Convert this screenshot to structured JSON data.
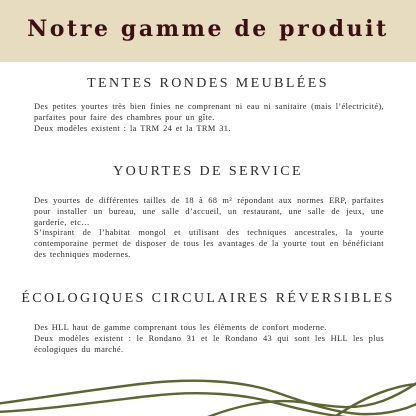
{
  "header": {
    "title": "Notre gamme de produit"
  },
  "sections": [
    {
      "title": "TENTES RONDES MEUBLÉES",
      "paragraphs": [
        "Des petites yourtes très bien finies ne comprenant ni eau ni sanitaire (mais l’électricité), parfaites pour faire des chambres pour un gîte.",
        "Deux modèles existent : la TRM 24 et la TRM 31."
      ]
    },
    {
      "title": "YOURTES DE SERVICE",
      "paragraphs": [
        "Des yourtes de différentes tailles de 18 à 68 m² répondant aux normes ERP, parfaites pour installer un bureau, une salle d’accueil, un restaurant, une salle de jeux, une garderie, etc…",
        "S’inspirant de l’habitat mongol et utilisant des techniques ancestrales, la yourte contemporaine permet de disposer de tous les avantages de la yourte tout en bénéficiant des techniques modernes."
      ]
    },
    {
      "title": "ÉCOLOGIQUES CIRCULAIRES RÉVERSIBLES",
      "paragraphs": [
        "Des HLL haut de gamme comprenant tous les éléments de confort moderne.",
        "Deux modèles existent : le Rondano 31 et le Rondano 43 qui sont les HLL les plus écologiques du marché."
      ]
    }
  ],
  "colors": {
    "banner_background": "#e8dcc0",
    "title_text": "#3a1010",
    "body_text": "#2b2b2b",
    "decor_lines": "#5e6432"
  }
}
